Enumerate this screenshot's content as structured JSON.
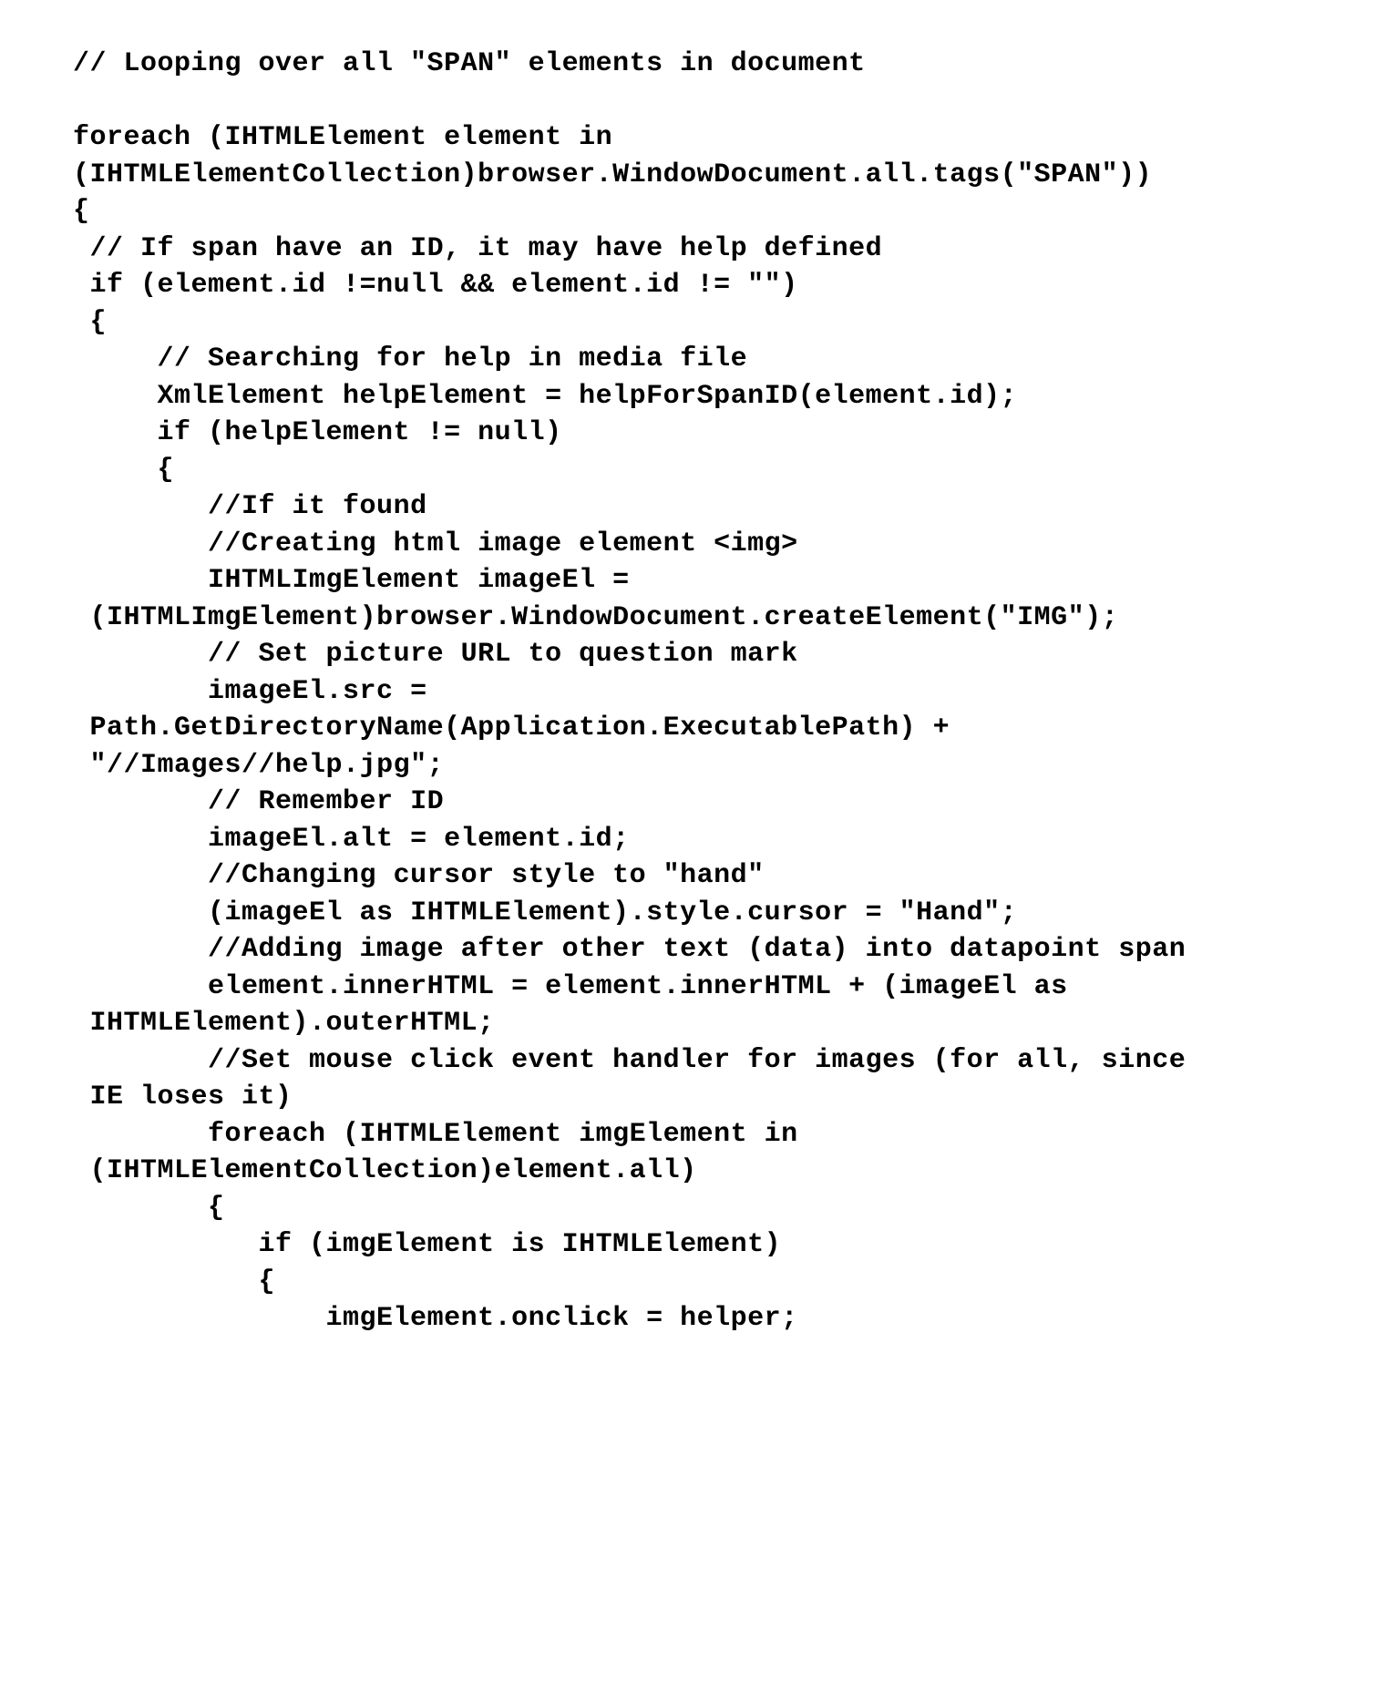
{
  "code": {
    "lines": [
      "// Looping over all \"SPAN\" elements in document",
      "",
      "foreach (IHTMLElement element in",
      "(IHTMLElementCollection)browser.WindowDocument.all.tags(\"SPAN\"))",
      "{",
      " // If span have an ID, it may have help defined",
      " if (element.id !=null && element.id != \"\")",
      " {",
      "     // Searching for help in media file",
      "     XmlElement helpElement = helpForSpanID(element.id);",
      "     if (helpElement != null)",
      "     {",
      "        //If it found",
      "        //Creating html image element <img>",
      "        IHTMLImgElement imageEl =",
      " (IHTMLImgElement)browser.WindowDocument.createElement(\"IMG\");",
      "        // Set picture URL to question mark",
      "        imageEl.src =",
      " Path.GetDirectoryName(Application.ExecutablePath) +",
      " \"//Images//help.jpg\";",
      "        // Remember ID",
      "        imageEl.alt = element.id;",
      "        //Changing cursor style to \"hand\"",
      "        (imageEl as IHTMLElement).style.cursor = \"Hand\";",
      "        //Adding image after other text (data) into datapoint span",
      "        element.innerHTML = element.innerHTML + (imageEl as",
      " IHTMLElement).outerHTML;",
      "        //Set mouse click event handler for images (for all, since",
      " IE loses it)",
      "        foreach (IHTMLElement imgElement in",
      " (IHTMLElementCollection)element.all)",
      "        {",
      "           if (imgElement is IHTMLElement)",
      "           {",
      "               imgElement.onclick = helper;"
    ]
  }
}
